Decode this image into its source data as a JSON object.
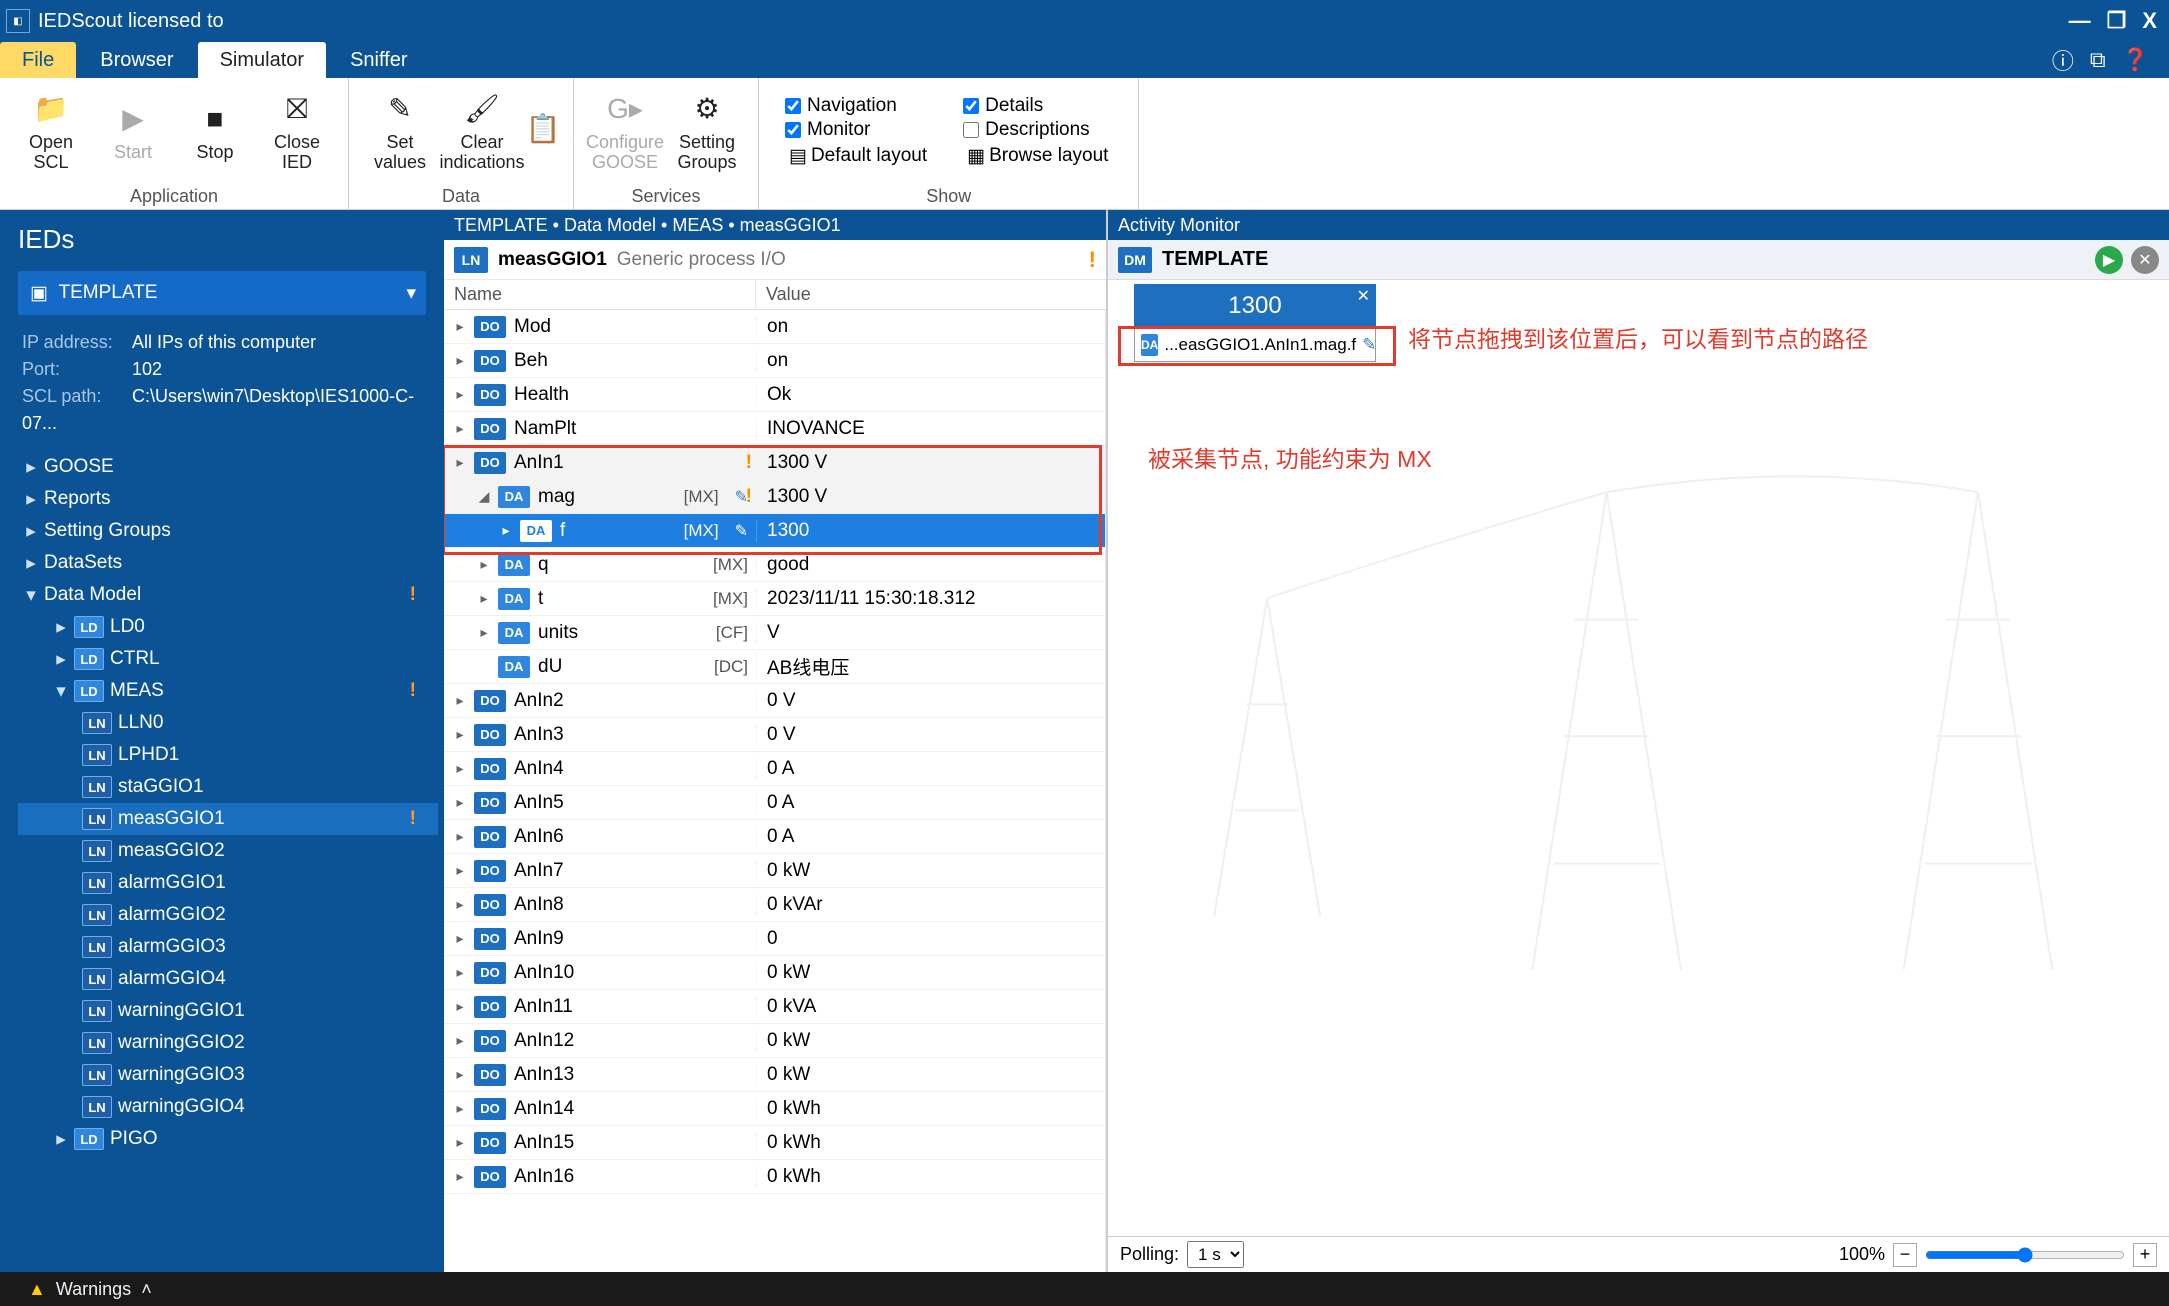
{
  "title": "IEDScout licensed to",
  "tabs": {
    "file": "File",
    "browser": "Browser",
    "simulator": "Simulator",
    "sniffer": "Sniffer"
  },
  "ribbon": {
    "app_group": "Application",
    "data_group": "Data",
    "services_group": "Services",
    "show_group": "Show",
    "open_scl": "Open\nSCL",
    "start": "Start",
    "stop": "Stop",
    "close_ied": "Close\nIED",
    "set_values": "Set\nvalues",
    "clear_indications": "Clear\nindications",
    "cfg_goose": "Configure\nGOOSE",
    "setting_groups": "Setting\nGroups",
    "nav": "Navigation",
    "monitor": "Monitor",
    "default_layout": "Default layout",
    "details": "Details",
    "descriptions": "Descriptions",
    "browse_layout": "Browse layout"
  },
  "left": {
    "title": "IEDs",
    "template": "TEMPLATE",
    "ip_lbl": "IP address:",
    "ip_val": "All IPs of this computer",
    "port_lbl": "Port:",
    "port_val": "102",
    "scl_lbl": "SCL path:",
    "scl_val": "C:\\Users\\win7\\Desktop\\IES1000-C-07...",
    "nodes": {
      "goose": "GOOSE",
      "reports": "Reports",
      "sg": "Setting Groups",
      "ds": "DataSets",
      "dm": "Data Model",
      "ld0": "LD0",
      "ctrl": "CTRL",
      "meas": "MEAS",
      "lln0": "LLN0",
      "lphd1": "LPHD1",
      "sta": "staGGIO1",
      "meas1": "measGGIO1",
      "meas2": "measGGIO2",
      "a1": "alarmGGIO1",
      "a2": "alarmGGIO2",
      "a3": "alarmGGIO3",
      "a4": "alarmGGIO4",
      "w1": "warningGGIO1",
      "w2": "warningGGIO2",
      "w3": "warningGGIO3",
      "w4": "warningGGIO4",
      "pigo": "PIGO"
    }
  },
  "center": {
    "breadcrumb": "TEMPLATE • Data Model • MEAS • measGGIO1",
    "ln_name": "measGGIO1",
    "ln_desc": "Generic process I/O",
    "col_name": "Name",
    "col_value": "Value",
    "rows": [
      {
        "type": "DO",
        "name": "Mod",
        "val": "on"
      },
      {
        "type": "DO",
        "name": "Beh",
        "val": "on"
      },
      {
        "type": "DO",
        "name": "Health",
        "val": "Ok"
      },
      {
        "type": "DO",
        "name": "NamPlt",
        "val": "INOVANCE"
      },
      {
        "type": "DO",
        "name": "AnIn1",
        "val": "1300 V",
        "exp": true,
        "warn": true
      },
      {
        "type": "DA",
        "name": "mag",
        "fc": "[MX]",
        "val": "1300 V",
        "indent": 1,
        "exp": true,
        "open": true,
        "pen": true,
        "warn": true
      },
      {
        "type": "DA",
        "name": "f",
        "fc": "[MX]",
        "val": "1300",
        "indent": 2,
        "sel": true,
        "pen": true
      },
      {
        "type": "DA",
        "name": "q",
        "fc": "[MX]",
        "val": "good",
        "indent": 1
      },
      {
        "type": "DA",
        "name": "t",
        "fc": "[MX]",
        "val": "2023/11/11 15:30:18.312",
        "indent": 1
      },
      {
        "type": "DA",
        "name": "units",
        "fc": "[CF]",
        "val": "V",
        "indent": 1
      },
      {
        "type": "DA",
        "name": "dU",
        "fc": "[DC]",
        "val": "AB线电压",
        "indent": 1,
        "noarrow": true
      },
      {
        "type": "DO",
        "name": "AnIn2",
        "val": "0 V"
      },
      {
        "type": "DO",
        "name": "AnIn3",
        "val": "0 V"
      },
      {
        "type": "DO",
        "name": "AnIn4",
        "val": "0 A"
      },
      {
        "type": "DO",
        "name": "AnIn5",
        "val": "0 A"
      },
      {
        "type": "DO",
        "name": "AnIn6",
        "val": "0 A"
      },
      {
        "type": "DO",
        "name": "AnIn7",
        "val": "0 kW"
      },
      {
        "type": "DO",
        "name": "AnIn8",
        "val": "0 kVAr"
      },
      {
        "type": "DO",
        "name": "AnIn9",
        "val": "0"
      },
      {
        "type": "DO",
        "name": "AnIn10",
        "val": "0 kW"
      },
      {
        "type": "DO",
        "name": "AnIn11",
        "val": "0 kVA"
      },
      {
        "type": "DO",
        "name": "AnIn12",
        "val": "0 kW"
      },
      {
        "type": "DO",
        "name": "AnIn13",
        "val": "0 kW"
      },
      {
        "type": "DO",
        "name": "AnIn14",
        "val": "0 kWh"
      },
      {
        "type": "DO",
        "name": "AnIn15",
        "val": "0 kWh"
      },
      {
        "type": "DO",
        "name": "AnIn16",
        "val": "0 kWh"
      }
    ]
  },
  "right": {
    "title": "Activity Monitor",
    "template": "TEMPLATE",
    "value": "1300",
    "path": "...easGGIO1.AnIn1.mag.f",
    "ann1": "将节点拖拽到该位置后，可以看到节点的路径",
    "ann2": "被采集节点, 功能约束为 MX",
    "polling_lbl": "Polling:",
    "polling_val": "1 s",
    "zoom": "100%"
  },
  "status": {
    "warnings": "Warnings"
  }
}
